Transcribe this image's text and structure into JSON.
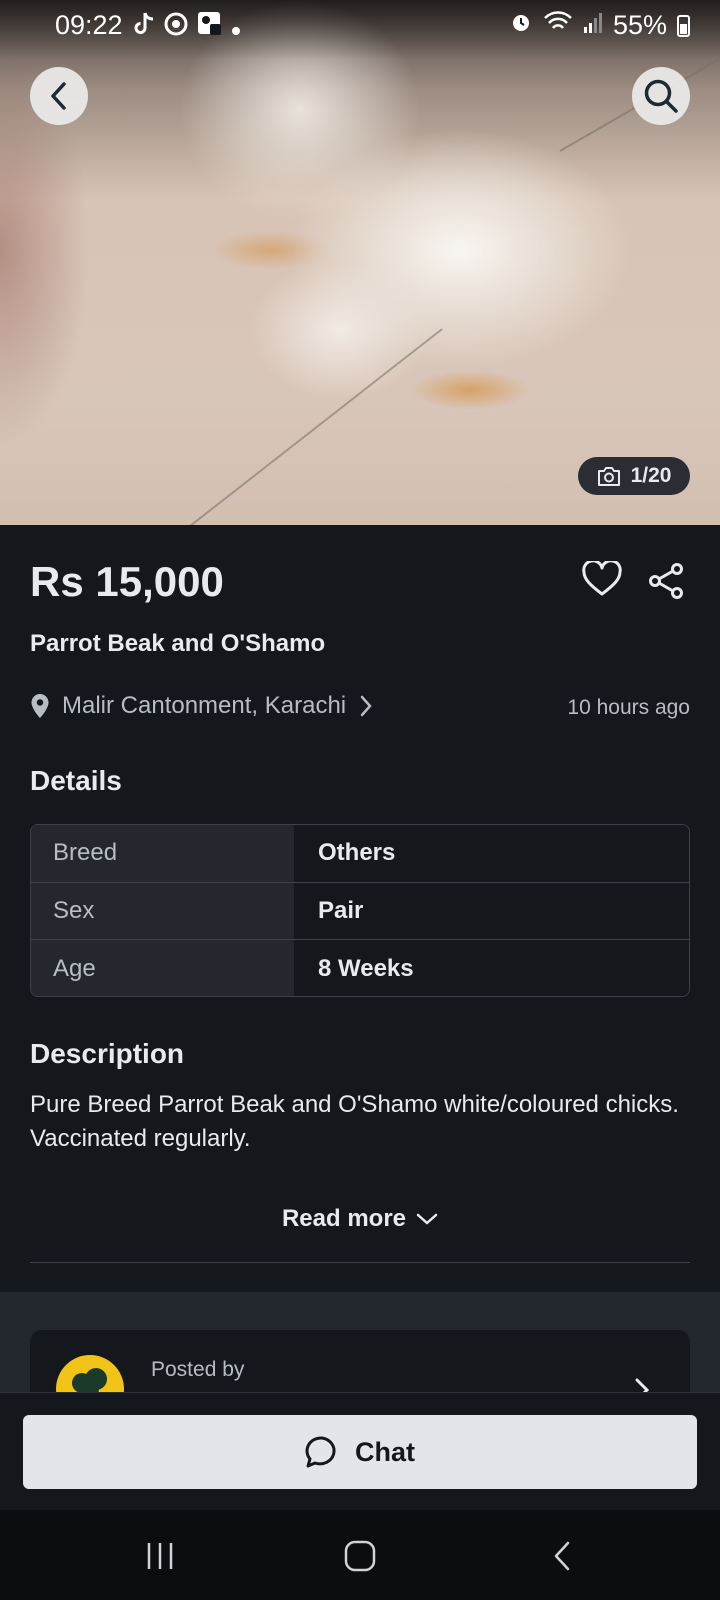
{
  "status_bar": {
    "time": "09:22",
    "battery": "55%"
  },
  "gallery": {
    "counter": "1/20"
  },
  "listing": {
    "price": "Rs 15,000",
    "title": "Parrot Beak and O'Shamo",
    "location": "Malir Cantonment, Karachi",
    "posted_time": "10 hours ago"
  },
  "details": {
    "heading": "Details",
    "rows": [
      {
        "key": "Breed",
        "value": "Others"
      },
      {
        "key": "Sex",
        "value": "Pair"
      },
      {
        "key": "Age",
        "value": "8 Weeks"
      }
    ]
  },
  "description": {
    "heading": "Description",
    "lines": [
      "Pure Breed Parrot Beak and O'Shamo white/coloured chicks.",
      "Vaccinated regularly."
    ],
    "read_more": "Read more"
  },
  "seller": {
    "posted_by_label": "Posted by"
  },
  "actions": {
    "chat_label": "Chat"
  },
  "colors": {
    "background": "#14171c",
    "chat_button": "#e2e5ea",
    "avatar": "#f2c417"
  },
  "icons": [
    "back-icon",
    "search-icon",
    "camera-icon",
    "heart-icon",
    "share-icon",
    "location-pin-icon",
    "chevron-right-icon",
    "chevron-down-icon",
    "chat-bubble-icon"
  ]
}
